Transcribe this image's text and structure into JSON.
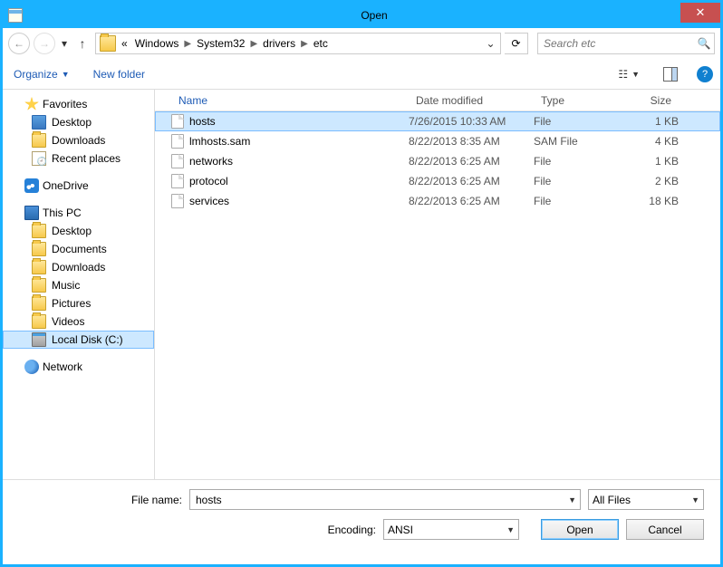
{
  "window": {
    "title": "Open"
  },
  "breadcrumb": {
    "prefix": "«",
    "items": [
      "Windows",
      "System32",
      "drivers",
      "etc"
    ]
  },
  "search": {
    "placeholder": "Search etc"
  },
  "toolbar": {
    "organize": "Organize",
    "new_folder": "New folder"
  },
  "columns": {
    "name": "Name",
    "date": "Date modified",
    "type": "Type",
    "size": "Size"
  },
  "files": [
    {
      "name": "hosts",
      "date": "7/26/2015 10:33 AM",
      "type": "File",
      "size": "1 KB",
      "selected": true
    },
    {
      "name": "lmhosts.sam",
      "date": "8/22/2013 8:35 AM",
      "type": "SAM File",
      "size": "4 KB",
      "selected": false
    },
    {
      "name": "networks",
      "date": "8/22/2013 6:25 AM",
      "type": "File",
      "size": "1 KB",
      "selected": false
    },
    {
      "name": "protocol",
      "date": "8/22/2013 6:25 AM",
      "type": "File",
      "size": "2 KB",
      "selected": false
    },
    {
      "name": "services",
      "date": "8/22/2013 6:25 AM",
      "type": "File",
      "size": "18 KB",
      "selected": false
    }
  ],
  "sidebar": {
    "favorites": {
      "label": "Favorites",
      "items": [
        "Desktop",
        "Downloads",
        "Recent places"
      ]
    },
    "onedrive": {
      "label": "OneDrive"
    },
    "pc": {
      "label": "This PC",
      "items": [
        "Desktop",
        "Documents",
        "Downloads",
        "Music",
        "Pictures",
        "Videos",
        "Local Disk (C:)"
      ],
      "selected": "Local Disk (C:)"
    },
    "network": {
      "label": "Network"
    }
  },
  "footer": {
    "filename_label": "File name:",
    "filename_value": "hosts",
    "filter": "All Files",
    "encoding_label": "Encoding:",
    "encoding_value": "ANSI",
    "open": "Open",
    "cancel": "Cancel"
  }
}
